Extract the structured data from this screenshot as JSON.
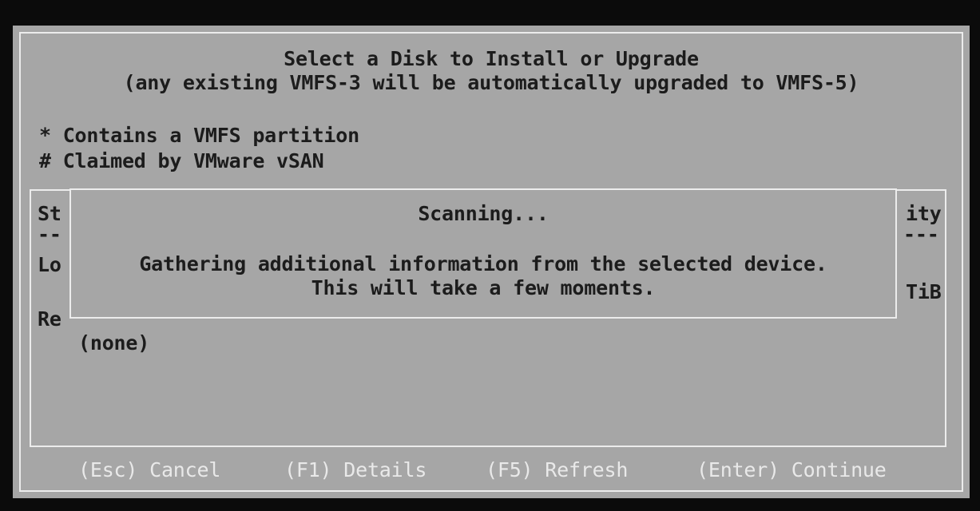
{
  "title": "Select a Disk to Install or Upgrade",
  "subtitle": "(any existing VMFS-3 will be automatically upgraded to VMFS-5)",
  "legend": {
    "vmfs": "* Contains a VMFS partition",
    "vsan": "# Claimed by VMware vSAN"
  },
  "list": {
    "col_storage_fragment": "St",
    "col_storage_sep": "--",
    "local_fragment": "Lo",
    "remote_fragment": "Re",
    "col_capacity_fragment": "ity",
    "col_capacity_sep": "---",
    "capacity_unit_fragment": "TiB",
    "remote_value": "(none)"
  },
  "dialog": {
    "title": "Scanning...",
    "line1": "Gathering additional information from the selected device.",
    "line2": "This will take a few moments."
  },
  "footer": {
    "cancel": "(Esc) Cancel",
    "details": "(F1) Details",
    "refresh": "(F5) Refresh",
    "continue": "(Enter) Continue"
  }
}
